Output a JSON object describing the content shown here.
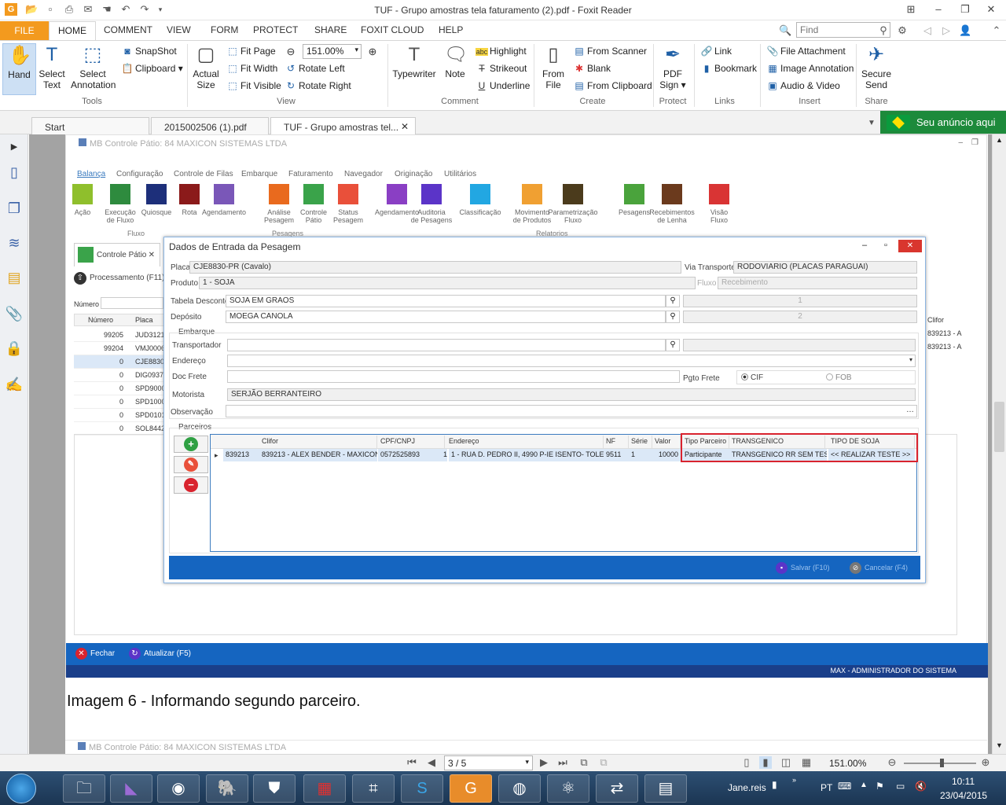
{
  "window": {
    "title": "TUF - Grupo amostras tela faturamento (2).pdf - Foxit Reader"
  },
  "menu": {
    "file": "FILE",
    "tabs": [
      "HOME",
      "COMMENT",
      "VIEW",
      "FORM",
      "PROTECT",
      "SHARE",
      "FOXIT CLOUD",
      "HELP"
    ],
    "find_placeholder": "Find"
  },
  "ribbon": {
    "tools": {
      "hand": "Hand",
      "select_text_1": "Select",
      "select_text_2": "Text",
      "select_annot_1": "Select",
      "select_annot_2": "Annotation",
      "snapshot": "SnapShot",
      "clipboard": "Clipboard",
      "group": "Tools"
    },
    "view": {
      "actual_size_1": "Actual",
      "actual_size_2": "Size",
      "fit_page": "Fit Page",
      "fit_width": "Fit Width",
      "fit_visible": "Fit Visible",
      "zoom": "151.00%",
      "rotate_left": "Rotate Left",
      "rotate_right": "Rotate Right",
      "group": "View"
    },
    "comment": {
      "typewriter": "Typewriter",
      "note": "Note",
      "highlight": "Highlight",
      "strikeout": "Strikeout",
      "underline": "Underline",
      "group": "Comment"
    },
    "create": {
      "from_file_1": "From",
      "from_file_2": "File",
      "from_scanner": "From Scanner",
      "blank": "Blank",
      "from_clipboard": "From Clipboard",
      "group": "Create"
    },
    "protect": {
      "pdf_sign_1": "PDF",
      "pdf_sign_2": "Sign",
      "group": "Protect"
    },
    "links": {
      "link": "Link",
      "bookmark": "Bookmark",
      "group": "Links"
    },
    "insert": {
      "file_attachment": "File Attachment",
      "image_annotation": "Image Annotation",
      "audio_video": "Audio & Video",
      "group": "Insert"
    },
    "share": {
      "secure_send_1": "Secure",
      "secure_send_2": "Send",
      "group": "Share"
    }
  },
  "doc_tabs": [
    "Start",
    "2015002506 (1).pdf",
    "TUF - Grupo amostras tel..."
  ],
  "ad_text": "Seu anúncio aqui",
  "mb_app": {
    "title": "MB Controle Pátio: 84 MAXICON SISTEMAS LTDA",
    "menu": [
      "Balança",
      "Configuração",
      "Controle de Filas",
      "Embarque",
      "Faturamento",
      "Navegador",
      "Originação",
      "Utilitários"
    ],
    "icons": [
      {
        "l1": "Ação",
        "l2": "",
        "color": "#8fbf2c"
      },
      {
        "l1": "Execução",
        "l2": "de Fluxo",
        "color": "#2e8b3e"
      },
      {
        "l1": "Quiosque",
        "l2": "",
        "color": "#1d2f7a"
      },
      {
        "l1": "Rota",
        "l2": "",
        "color": "#8b1a1a"
      },
      {
        "l1": "Agendamento",
        "l2": "",
        "color": "#7a57b8"
      },
      {
        "l1": "Análise",
        "l2": "Pesagem",
        "color": "#e96a1e"
      },
      {
        "l1": "Controle",
        "l2": "Pátio",
        "color": "#3aa34a"
      },
      {
        "l1": "Status",
        "l2": "Pesagem",
        "color": "#e9503a"
      },
      {
        "l1": "Agendamento",
        "l2": "",
        "color": "#8a3fc4"
      },
      {
        "l1": "Auditoria",
        "l2": "de Pesagens",
        "color": "#5b34c8"
      },
      {
        "l1": "Classificação",
        "l2": "",
        "color": "#22a7e2"
      },
      {
        "l1": "Movimento",
        "l2": "de Produtos",
        "color": "#f0a032"
      },
      {
        "l1": "Parametrização",
        "l2": "Fluxo",
        "color": "#4b3b1c"
      },
      {
        "l1": "Pesagens",
        "l2": "",
        "color": "#4aa33c"
      },
      {
        "l1": "Recebimentos",
        "l2": "de Lenha",
        "color": "#6b3a1d"
      },
      {
        "l1": "Visão",
        "l2": "Fluxo",
        "color": "#d93434"
      }
    ],
    "groups": [
      "Fluxo",
      "Pesagens",
      "Relatorios"
    ],
    "inner_tab": "Controle Pátio",
    "processing": "Processamento (F11)",
    "numero_label": "Número",
    "grid_headers": [
      "Número",
      "Placa"
    ],
    "grid_rows": [
      [
        "99205",
        "JUD3121"
      ],
      [
        "99204",
        "VMJ0006"
      ],
      [
        "0",
        "CJE8830"
      ],
      [
        "0",
        "DIG0937"
      ],
      [
        "0",
        "SPD9000"
      ],
      [
        "0",
        "SPD1000"
      ],
      [
        "0",
        "SPD0101"
      ],
      [
        "0",
        "SOL8442"
      ]
    ],
    "right_col_header": "Clifor",
    "right_col_rows": [
      "839213 - A",
      "839213 - A"
    ],
    "fechar": "Fechar",
    "atualizar": "Atualizar (F5)",
    "user": "MAX - ADMINISTRADOR DO SISTEMA"
  },
  "dialog": {
    "title": "Dados de Entrada da Pesagem",
    "placa_label": "Placa",
    "placa": "CJE8830-PR (Cavalo)",
    "via_label": "Via Transporte",
    "via": "RODOVIARIO (PLACAS PARAGUAI)",
    "produto_label": "Produto",
    "produto": "1 - SOJA",
    "fluxo_label": "Fluxo",
    "fluxo": "Recebimento",
    "tabela_label": "Tabela Desconto",
    "tabela": "SOJA EM GRAOS",
    "tabela_num": "1",
    "deposito_label": "Depósito",
    "deposito": "MOEGA CANOLA",
    "deposito_num": "2",
    "embarque_label": "Embarque",
    "transportador_label": "Transportador",
    "endereco_label": "Endereço",
    "docfrete_label": "Doc Frete",
    "pgto_label": "Pgto Frete",
    "cif": "CIF",
    "fob": "FOB",
    "motorista_label": "Motorista",
    "motorista": "SERJÃO BERRANTEIRO",
    "observacao_label": "Observação",
    "parceiros_label": "Parceiros",
    "partner_headers": [
      "Clifor",
      "CPF/CNPJ",
      "Endereço",
      "NF",
      "Série",
      "Valor",
      "Tipo Parceiro",
      "TRANSGENICO",
      "TIPO DE SOJA"
    ],
    "partner_row": [
      "839213",
      "839213 - ALEX BENDER - MAXICON",
      "0572525893",
      "1",
      "1 - RUA D. PEDRO II, 4990 P-IE ISENTO- TOLE...",
      "9511",
      "1",
      "10000",
      "Participante",
      "TRANSGENICO RR SEM TESTE",
      "<< REALIZAR TESTE >>"
    ],
    "salvar": "Salvar (F10)",
    "cancelar": "Cancelar (F4)"
  },
  "caption": "Imagem 6 - Informando segundo parceiro.",
  "status": {
    "page": "3 / 5",
    "zoom": "151.00%"
  },
  "taskbar": {
    "user": "Jane.reis",
    "lang": "PT",
    "time": "10:11",
    "date": "23/04/2015"
  }
}
